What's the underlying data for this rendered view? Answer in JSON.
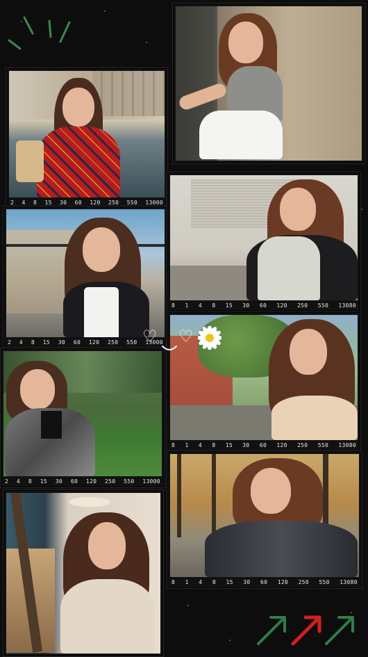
{
  "film_strip": {
    "iso_labels": [
      "2",
      "4",
      "8",
      "15",
      "30",
      "60",
      "120",
      "250",
      "550",
      "13000"
    ],
    "iso_labels_alt": [
      "8",
      "1",
      "4",
      "8",
      "15",
      "30",
      "60",
      "120",
      "250",
      "550",
      "13080"
    ]
  },
  "decorations": {
    "heart_icon": "heart-outline-icon",
    "flower_icon": "daisy-icon",
    "arrow_icons": [
      "arrow-up-right-icon",
      "arrow-up-right-icon",
      "arrow-up-right-icon"
    ],
    "arrow_colors": [
      "#2f7d4a",
      "#d41f1f",
      "#2f7d4a"
    ],
    "spark_color": "#3a8a4e",
    "heart_glyph": "♡"
  },
  "palette": {
    "background": "#0d0d0d",
    "frame": "#111111",
    "strip_text": "#e8e8e8"
  }
}
